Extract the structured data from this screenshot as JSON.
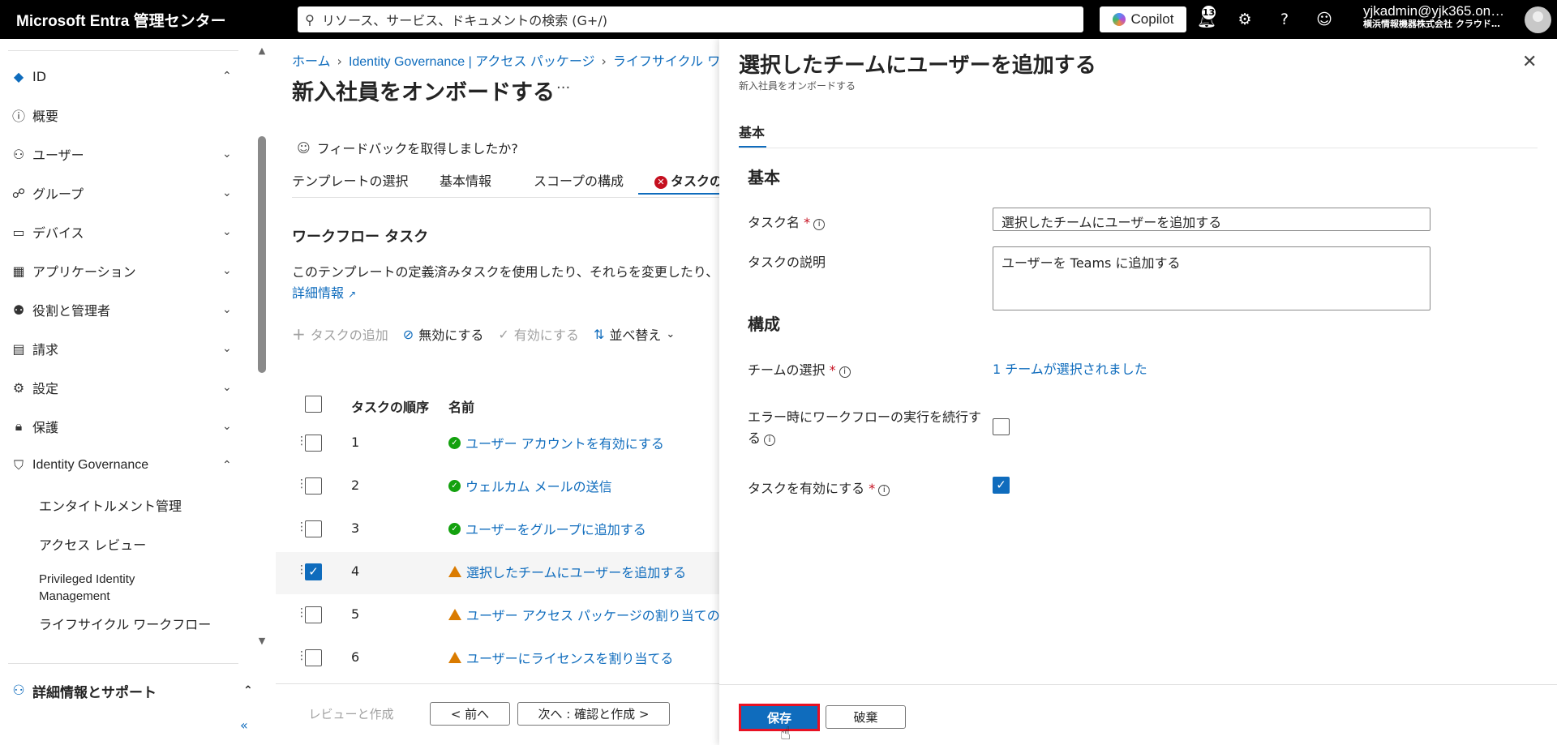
{
  "topbar": {
    "brand": "Microsoft Entra 管理センター",
    "search_placeholder": "リソース、サービス、ドキュメントの検索 (G+/)",
    "copilot_label": "Copilot",
    "notification_count": "13",
    "account_name": "yjkadmin@yjk365.on…",
    "account_org": "横浜情報機器株式会社 クラウド…"
  },
  "sidebar": {
    "items": [
      {
        "label": "ID",
        "icon": "diamond-icon"
      },
      {
        "label": "概要",
        "icon": "info-icon"
      },
      {
        "label": "ユーザー",
        "icon": "person-icon"
      },
      {
        "label": "グループ",
        "icon": "group-icon"
      },
      {
        "label": "デバイス",
        "icon": "device-icon"
      },
      {
        "label": "アプリケーション",
        "icon": "apps-icon"
      },
      {
        "label": "役割と管理者",
        "icon": "roles-icon"
      },
      {
        "label": "請求",
        "icon": "billing-icon"
      },
      {
        "label": "設定",
        "icon": "gear-icon"
      },
      {
        "label": "保護",
        "icon": "lock-icon"
      },
      {
        "label": "Identity Governance",
        "icon": "governance-icon"
      }
    ],
    "sub_items": [
      "エンタイトルメント管理",
      "アクセス レビュー",
      "Privileged Identity Management",
      "ライフサイクル ワークフロー"
    ],
    "help_label": "詳細情報とサポート"
  },
  "main": {
    "breadcrumb": [
      "ホーム",
      "Identity Governance | アクセス パッケージ",
      "ライフサイクル ワー"
    ],
    "title": "新入社員をオンボードする",
    "feedback": "フィードバックを取得しましたか?",
    "tabs": [
      "テンプレートの選択",
      "基本情報",
      "スコープの構成",
      "タスクの確"
    ],
    "section_heading": "ワークフロー タスク",
    "description": "このテンプレートの定義済みタスクを使用したり、それらを変更したり、タ",
    "more_link": "詳細情報",
    "toolbar": {
      "add": "タスクの追加",
      "disable": "無効にする",
      "enable": "有効にする",
      "sort": "並べ替え"
    },
    "columns": [
      "タスクの順序",
      "名前"
    ],
    "rows": [
      {
        "order": "1",
        "name": "ユーザー アカウントを有効にする",
        "status": "ok"
      },
      {
        "order": "2",
        "name": "ウェルカム メールの送信",
        "status": "ok"
      },
      {
        "order": "3",
        "name": "ユーザーをグループに追加する",
        "status": "ok"
      },
      {
        "order": "4",
        "name": "選択したチームにユーザーを追加する",
        "status": "warn"
      },
      {
        "order": "5",
        "name": "ユーザー アクセス パッケージの割り当ての要",
        "status": "warn"
      },
      {
        "order": "6",
        "name": "ユーザーにライセンスを割り当てる",
        "status": "warn"
      }
    ],
    "footer": {
      "review": "レビューと作成",
      "prev": "< 前へ",
      "next": "次へ : 確認と作成 >"
    }
  },
  "panel": {
    "title": "選択したチームにユーザーを追加する",
    "subtitle": "新入社員をオンボードする",
    "tab": "基本",
    "section_basic": "基本",
    "task_name_label": "タスク名",
    "task_name_value": "選択したチームにユーザーを追加する",
    "task_desc_label": "タスクの説明",
    "task_desc_value": "ユーザーを Teams に追加する",
    "section_config": "構成",
    "team_label": "チームの選択",
    "team_value": "1 チームが選択されました",
    "continue_label_1": "エラー時にワークフローの実行を続行す",
    "continue_label_2": "る",
    "enable_label": "タスクを有効にする",
    "save": "保存",
    "discard": "破棄"
  },
  "colors": {
    "accent": "#0f6cbd",
    "ok": "#13a10e",
    "warn": "#da7b00",
    "error": "#c50f1f"
  }
}
